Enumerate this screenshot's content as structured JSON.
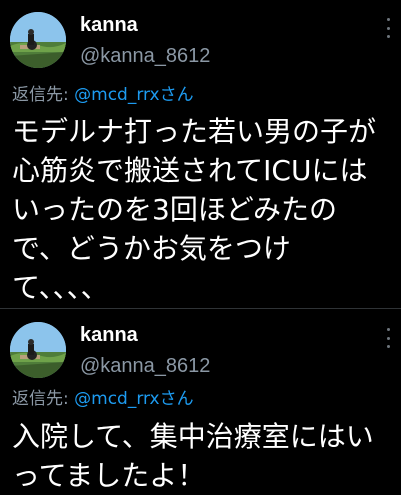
{
  "tweets": [
    {
      "display_name": "kanna",
      "handle": "@kanna_8612",
      "reply_prefix": "返信先: ",
      "reply_to": "@mcd_rrxさん",
      "text": "モデルナ打った若い男の子が\n心筋炎で搬送されてICUには\nいったのを3回ほどみたの\nで、どうかお気をつけ\nて、、、、"
    },
    {
      "display_name": "kanna",
      "handle": "@kanna_8612",
      "reply_prefix": "返信先: ",
      "reply_to": "@mcd_rrxさん",
      "text": "入院して、集中治療室にはい\nってましたよ！"
    }
  ],
  "colors": {
    "background": "#000000",
    "primary_text": "#ffffff",
    "secondary_text": "#8b98a5",
    "link": "#1d9bf0",
    "divider": "#2f3336"
  },
  "icons": {
    "more": "more-horizontal-icon",
    "avatar": "avatar"
  }
}
